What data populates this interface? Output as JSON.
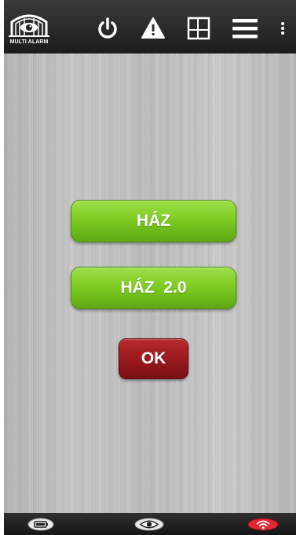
{
  "app": {
    "logo_text": "MULTI ALARM"
  },
  "toolbar": {
    "icons": [
      "power-icon",
      "warning-icon",
      "layout-icon",
      "menu-icon",
      "overflow-icon"
    ]
  },
  "main": {
    "house_button_label": "HÁZ",
    "house2_button_label": "HÁZ  2.0",
    "ok_button_label": "OK"
  },
  "status_bar": {
    "icons": [
      "battery-icon",
      "eye-icon",
      "wifi-icon"
    ],
    "wifi_status_color": "#e32636"
  },
  "colors": {
    "accent_green": "#7fcc24",
    "ok_red": "#9a1a1f",
    "bar_dark": "#242424"
  }
}
